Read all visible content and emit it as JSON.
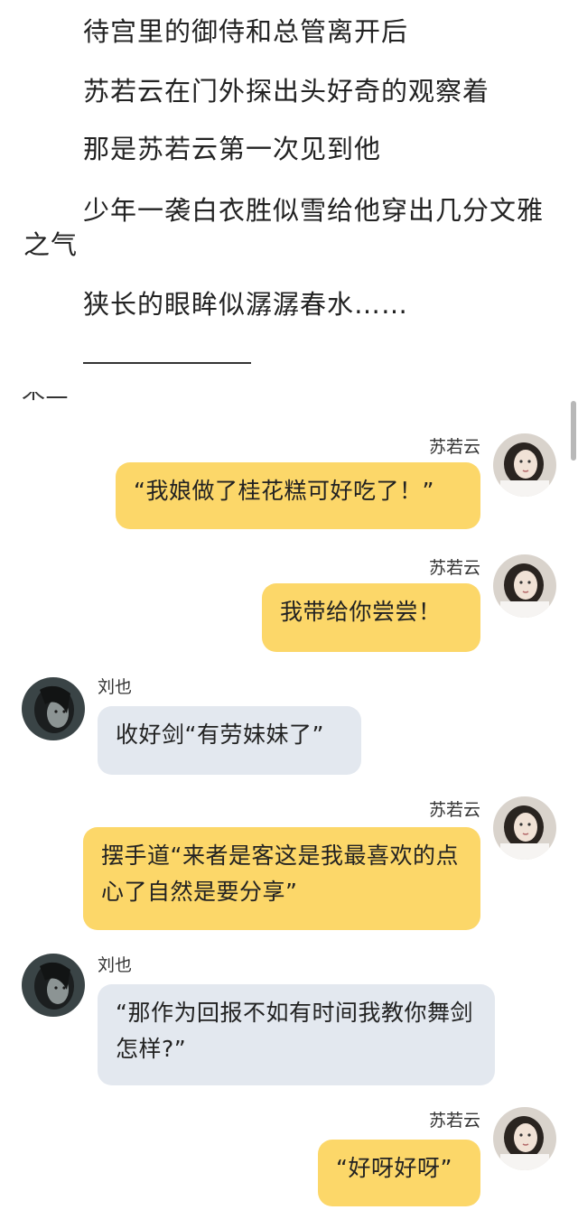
{
  "story": {
    "lines": [
      "待宫里的御侍和总管离开后",
      "苏若云在门外探出头好奇的观察着",
      "那是苏若云第一次见到他",
      "少年一袭白衣胜似雪给他穿出几分文雅之气",
      "狭长的眼眸似潺潺春水……"
    ],
    "cutoff_text": "来三"
  },
  "chat": [
    {
      "side": "right",
      "name": "苏若云",
      "text": "“我娘做了桂花糕可好吃了！”",
      "avatar": "su-ruoyun-avatar-icon"
    },
    {
      "side": "right",
      "name": "苏若云",
      "text": "我带给你尝尝！",
      "avatar": "su-ruoyun-avatar-icon"
    },
    {
      "side": "left",
      "name": "刘也",
      "text": "收好剑“有劳妹妹了”",
      "avatar": "liu-ye-avatar-icon"
    },
    {
      "side": "right",
      "name": "苏若云",
      "text": "摆手道“来者是客这是我最喜欢的点心了自然是要分享”",
      "avatar": "su-ruoyun-avatar-icon"
    },
    {
      "side": "left",
      "name": "刘也",
      "text": "“那作为回报不如有时间我教你舞剑怎样?”",
      "avatar": "liu-ye-avatar-icon"
    },
    {
      "side": "right",
      "name": "苏若云",
      "text": "“好呀好呀”",
      "avatar": "su-ruoyun-avatar-icon"
    }
  ],
  "colors": {
    "right_bubble": "#fcd769",
    "left_bubble": "#e3e8ef",
    "text": "#222222"
  }
}
